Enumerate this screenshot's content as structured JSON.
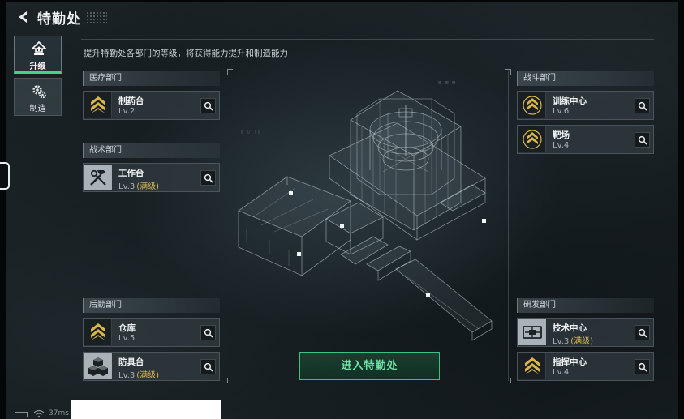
{
  "header": {
    "title": "特勤处",
    "subtitle": "提升特勤处各部门的等级，将获得能力提升和制造能力"
  },
  "nav": [
    {
      "label": "升级",
      "icon": "upgrade-icon",
      "active": true
    },
    {
      "label": "制造",
      "icon": "gears-icon",
      "active": false
    }
  ],
  "sections": {
    "medical": {
      "title": "医疗部门",
      "items": [
        {
          "name": "制药台",
          "level": "Lv.2",
          "max": "",
          "icon": "rank-chevron-icon"
        }
      ]
    },
    "tactical": {
      "title": "战术部门",
      "items": [
        {
          "name": "工作台",
          "level": "Lv.3",
          "max": "(满级)",
          "icon": "hammer-wrench-icon"
        }
      ]
    },
    "logistics": {
      "title": "后勤部门",
      "items": [
        {
          "name": "仓库",
          "level": "Lv.5",
          "max": "",
          "icon": "rank-chevron-icon"
        },
        {
          "name": "防具台",
          "level": "Lv.3",
          "max": "(满级)",
          "icon": "cubes-icon"
        }
      ]
    },
    "combat": {
      "title": "战斗部门",
      "items": [
        {
          "name": "训练中心",
          "level": "Lv.6",
          "max": "",
          "icon": "rank-chevron-icon"
        },
        {
          "name": "靶场",
          "level": "Lv.4",
          "max": "",
          "icon": "rank-chevron-icon"
        }
      ]
    },
    "research": {
      "title": "研发部门",
      "items": [
        {
          "name": "技术中心",
          "level": "Lv.3",
          "max": "(满级)",
          "icon": "circuit-board-icon"
        },
        {
          "name": "指挥中心",
          "level": "Lv.4",
          "max": "",
          "icon": "rank-chevron-icon"
        }
      ]
    }
  },
  "enter_button": "进入特勤处",
  "status": {
    "ping": "37ms"
  },
  "colors": {
    "accent_green": "#3fd38c",
    "max_gold": "#d8b757",
    "rank_gold": "#d9b54a"
  }
}
